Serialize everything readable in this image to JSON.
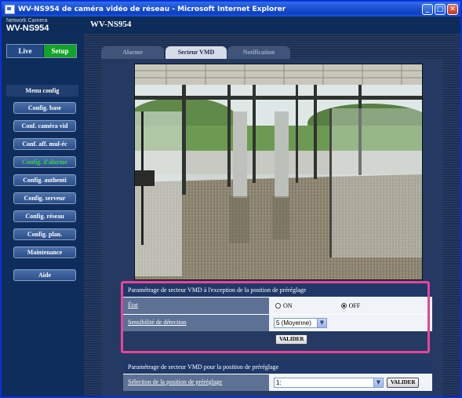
{
  "window": {
    "title": "WV-NS954 de caméra vidéo de réseau - Microsoft Internet Explorer",
    "controls": [
      "_",
      "□",
      "✕"
    ]
  },
  "header": {
    "brand_small": "Network Camera",
    "brand_model": "WV-NS954",
    "page_model": "WV-NS954"
  },
  "mode": {
    "live": "Live",
    "setup": "Setup"
  },
  "sidebar": {
    "menu_title": "Menu config",
    "items": [
      {
        "label": "Config. base",
        "active": false
      },
      {
        "label": "Conf. caméra vid",
        "active": false
      },
      {
        "label": "Conf. aff. mul-éc",
        "active": false
      },
      {
        "label": "Config. d'alarme",
        "active": true
      },
      {
        "label": "Config. authenti",
        "active": false
      },
      {
        "label": "Config. serveur",
        "active": false
      },
      {
        "label": "Config. réseau",
        "active": false
      },
      {
        "label": "Config. plan.",
        "active": false
      },
      {
        "label": "Maintenance",
        "active": false
      }
    ],
    "help": "Aide"
  },
  "tabs": [
    {
      "label": "Alarme",
      "active": false
    },
    {
      "label": "Secteur VMD",
      "active": true
    },
    {
      "label": "Notification",
      "active": false
    }
  ],
  "panel1": {
    "title": "Paramétrage de secteur VMD à l'exception de la position de préréglage",
    "state_label": "État",
    "on_label": "ON",
    "off_label": "OFF",
    "selected": "OFF",
    "sensitivity_label": "Sensibilité de détection",
    "sensitivity_value": "5 (Moyenne)",
    "submit": "VALIDER"
  },
  "panel2": {
    "title": "Paramétrage de secteur VMD pour la position de préréglage",
    "preset_label": "Sélection de la position de préréglage",
    "preset_value": "1:",
    "submit": "VALIDER"
  },
  "colors": {
    "accent_active": "#2fd14a",
    "highlight": "#e8439c",
    "setup_green": "#13a329"
  }
}
